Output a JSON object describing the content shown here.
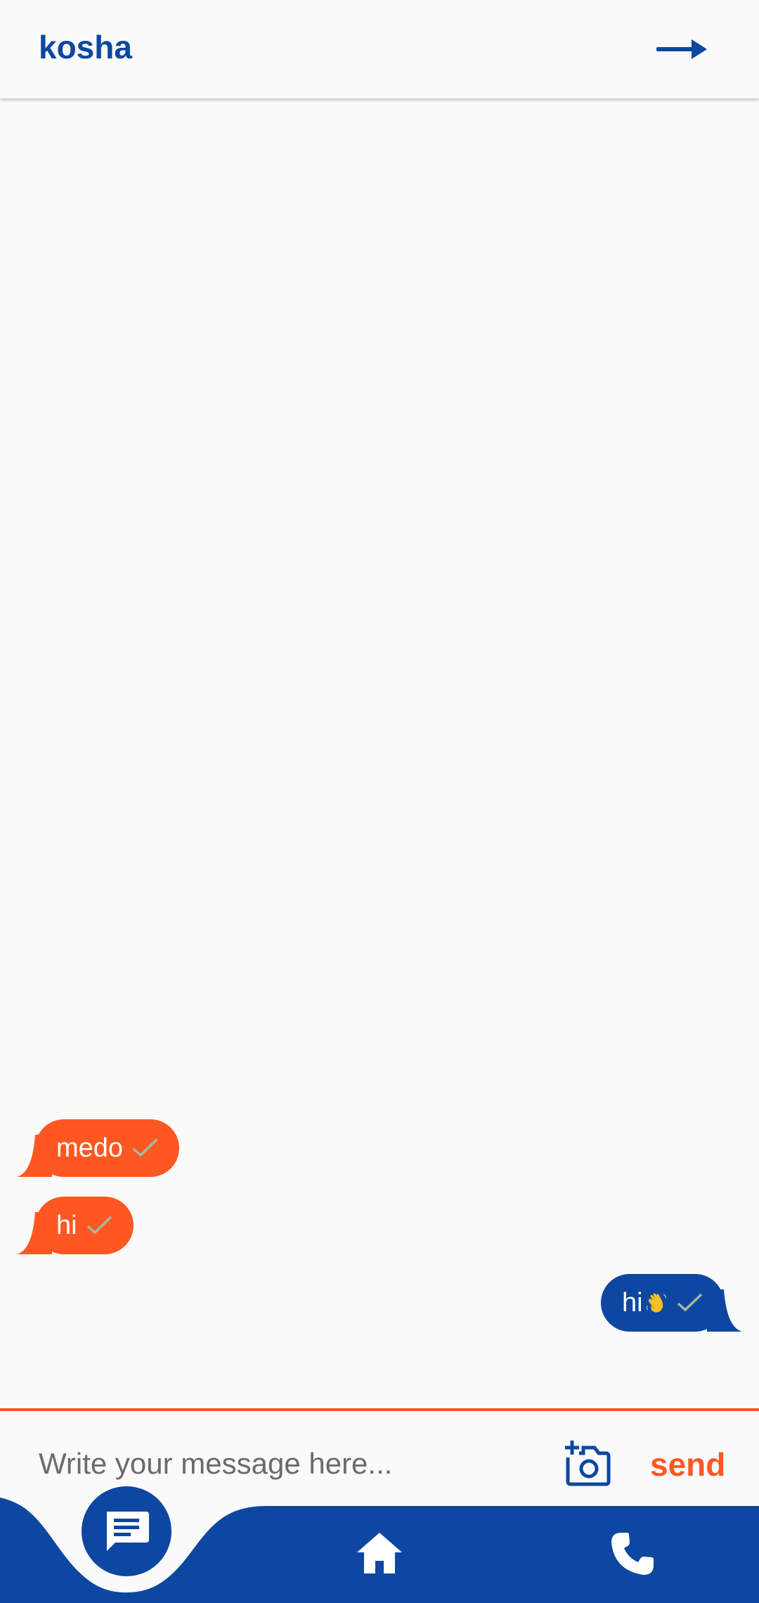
{
  "app_bar": {
    "title": "kosha",
    "action_icon": "arrow-right-icon"
  },
  "messages": [
    {
      "text": "medo",
      "direction": "incoming",
      "status_icon": "check-icon"
    },
    {
      "text": "hi",
      "direction": "incoming",
      "status_icon": "check-icon"
    },
    {
      "text": "hi",
      "emoji": "waving-hand-icon",
      "direction": "outgoing",
      "status_icon": "check-icon"
    }
  ],
  "composer": {
    "value": "",
    "placeholder": "Write your message here...",
    "camera_icon": "add-photo-camera-icon",
    "send_label": "send"
  },
  "bottom_nav": {
    "items": [
      {
        "icon": "chat-icon",
        "active": true
      },
      {
        "icon": "home-icon",
        "active": false
      },
      {
        "icon": "phone-icon",
        "active": false
      }
    ]
  },
  "colors": {
    "primary": "#0d47a1",
    "accent": "#ff5722",
    "background": "#fafafa",
    "check": "#a7b8a0"
  }
}
